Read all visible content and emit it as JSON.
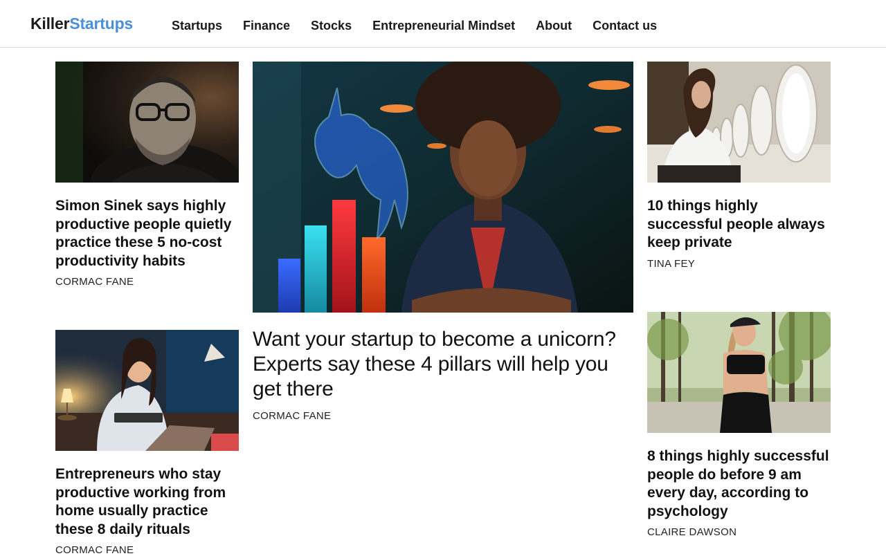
{
  "brand": {
    "name_part1": "Killer",
    "name_part2": "Startups"
  },
  "nav": {
    "items": [
      "Startups",
      "Finance",
      "Stocks",
      "Entrepreneurial Mindset",
      "About",
      "Contact us"
    ]
  },
  "articles": [
    {
      "title": "Simon Sinek says highly productive people quietly practice these 5 no-cost productivity habits",
      "author": "CORMAC FANE"
    },
    {
      "title": "Want your startup to become a unicorn? Experts say these 4 pillars will help you get there",
      "author": "CORMAC FANE"
    },
    {
      "title": "10 things highly successful people always keep private",
      "author": "TINA FEY"
    },
    {
      "title": "Entrepreneurs who stay productive working from home usually practice these 8 daily rituals",
      "author": "CORMAC FANE"
    },
    {
      "title": "8 things highly successful people do before 9 am every day, according to psychology",
      "author": "CLAIRE DAWSON"
    }
  ],
  "colors": {
    "brand_blue": "#4a8fd8",
    "text": "#111111",
    "divider": "#d9d9d9"
  }
}
